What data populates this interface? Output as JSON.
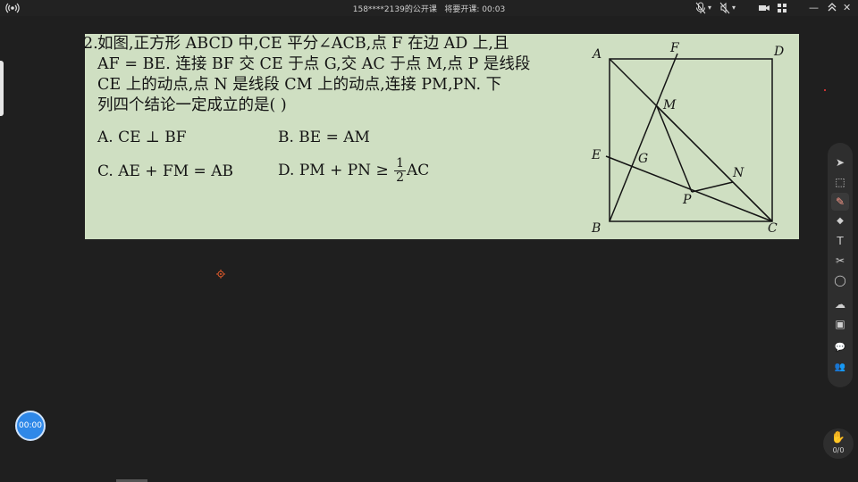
{
  "topbar": {
    "title": "158****2139的公开课   将要开课: 00:03",
    "icons": [
      "live-signal-icon",
      "microphone-muted-icon",
      "speaker-muted-icon",
      "camera-icon",
      "grid-icon",
      "minimize-icon",
      "close-icon"
    ],
    "dropdown_glyph": "▾",
    "minimize_glyph": "—",
    "close_glyph": "✕"
  },
  "question": {
    "number": "2.",
    "lines": [
      "如图,正方形 ABCD 中,CE 平分∠ACB,点 F 在边 AD 上,且",
      "AF = BE. 连接 BF 交 CE 于点 G,交 AC 于点 M,点 P 是线段",
      "CE 上的动点,点 N 是线段 CM 上的动点,连接 PM,PN. 下",
      "列四个结论一定成立的是(        )"
    ],
    "options": {
      "a": "A. CE ⊥ BF",
      "b": "B. BE = AM",
      "c": "C. AE + FM = AB",
      "d_prefix": "D. PM + PN ≥ ",
      "d_num": "1",
      "d_den": "2",
      "d_suffix": "AC"
    }
  },
  "figure": {
    "labels": {
      "A": "A",
      "B": "B",
      "C": "C",
      "D": "D",
      "E": "E",
      "F": "F",
      "G": "G",
      "M": "M",
      "N": "N",
      "P": "P"
    },
    "line_color": "#141414"
  },
  "toolbar": {
    "tools": [
      "cursor-icon",
      "select-icon",
      "pen-icon",
      "eraser-icon",
      "text-icon",
      "scissors-icon",
      "shape-icon",
      "cloud-icon",
      "toolbox-icon",
      "chat-icon",
      "users-icon"
    ],
    "glyphs": [
      "➤",
      "⬚",
      "✎",
      "◆",
      "T",
      "✂",
      "◯",
      "☁",
      "▣",
      "💬",
      "👥"
    ],
    "hand_icon_glyph": "✋",
    "hand_count": "0/0"
  },
  "timer": {
    "value": "00:00",
    "color": "#2f88e8"
  }
}
